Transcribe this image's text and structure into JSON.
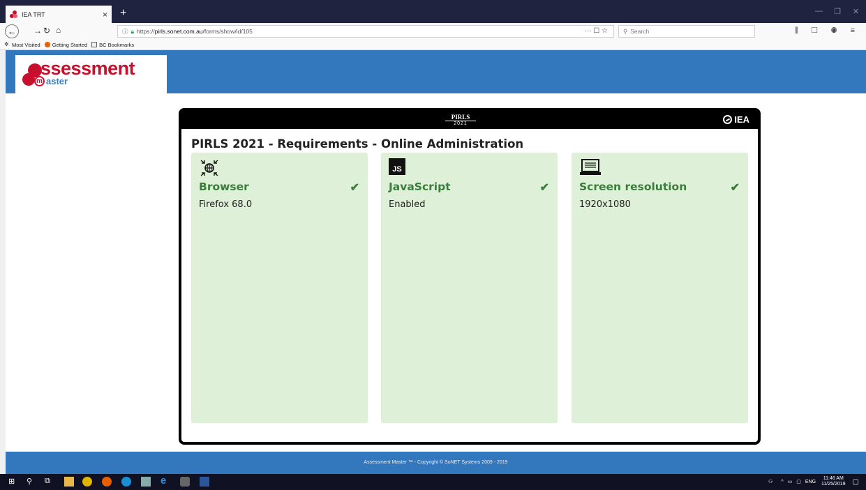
{
  "browser": {
    "tab_title": "IEA TRT",
    "tab_close": "×",
    "new_tab": "+",
    "url_prefix": "https://",
    "url_host": "pirls.sonet.com.au",
    "url_path": "/forms/show/id/105",
    "url_actions": "··· ☐ ☆",
    "search_placeholder": "Search",
    "bookmarks": [
      {
        "label": "Most Visited"
      },
      {
        "label": "Getting Started"
      },
      {
        "label": "BC Bookmarks"
      }
    ]
  },
  "header": {
    "logo_main": "ssessment",
    "logo_m": "m",
    "logo_sub": "aster"
  },
  "card": {
    "pirls_name": "PIRLS",
    "pirls_year": "2021",
    "iea": "IEA",
    "title": "PIRLS 2021 - Requirements - Online Administration",
    "requirements": [
      {
        "name": "Browser",
        "value": "Firefox 68.0",
        "icon": "network-globe-icon",
        "check": "✔"
      },
      {
        "name": "JavaScript",
        "value": "Enabled",
        "icon": "js-icon",
        "icon_text": "JS",
        "check": "✔"
      },
      {
        "name": "Screen resolution",
        "value": "1920x1080",
        "icon": "laptop-icon",
        "check": "✔"
      }
    ]
  },
  "footer": {
    "text": "Assessment Master ™ - Copyright © SoNET Systems 2009 - 2019"
  },
  "taskbar": {
    "lang": "ENG",
    "time": "11:46 AM",
    "date": "11/25/2019"
  },
  "colors": {
    "header_blue": "#3377bd",
    "brand_red": "#c8102e",
    "success_green": "#3b7d3b",
    "card_green_bg": "#dff0d8"
  }
}
